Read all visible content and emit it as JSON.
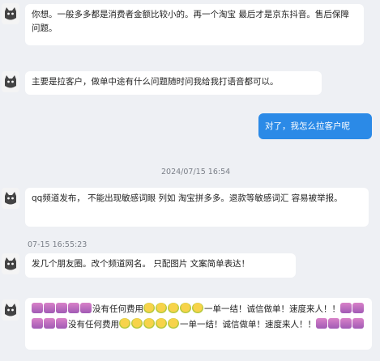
{
  "timestamp_center": "2024/07/15 16:54",
  "timestamp_left": "07-15 16:55:23",
  "messages": [
    {
      "side": "left",
      "text": "你想。一般多多都是消费者金额比较小的。再一个淘宝 最后才是京东抖音。售后保障问题。"
    },
    {
      "side": "left",
      "text": "主要是拉客户，做单中途有什么问题随时问我给我打语音都可以。"
    },
    {
      "side": "right",
      "text": "对了，我怎么拉客户呢"
    },
    {
      "side": "left",
      "text": "qq频道发布， 不能出现敏感词眼 列如 淘宝拼多多。退款等敏感词汇 容易被举报。"
    },
    {
      "side": "left",
      "text": "发几个朋友圈。改个频道网名。 只配图片 文案简单表达！"
    },
    {
      "side": "left",
      "text_a": "没有任何费用",
      "text_b": "一单一结！诚信做单！速度来人！！",
      "text_c": "没有任何费用",
      "text_d": "一单一结！诚信做单！速度来人！！"
    }
  ],
  "icons": {
    "avatar": "cat-avatar-icon",
    "cat_emoji": "cat-emoji-icon",
    "face_emoji": "sun-face-emoji-icon"
  },
  "colors": {
    "me_bubble": "#2b8ae7",
    "background": "#eef0f4"
  }
}
